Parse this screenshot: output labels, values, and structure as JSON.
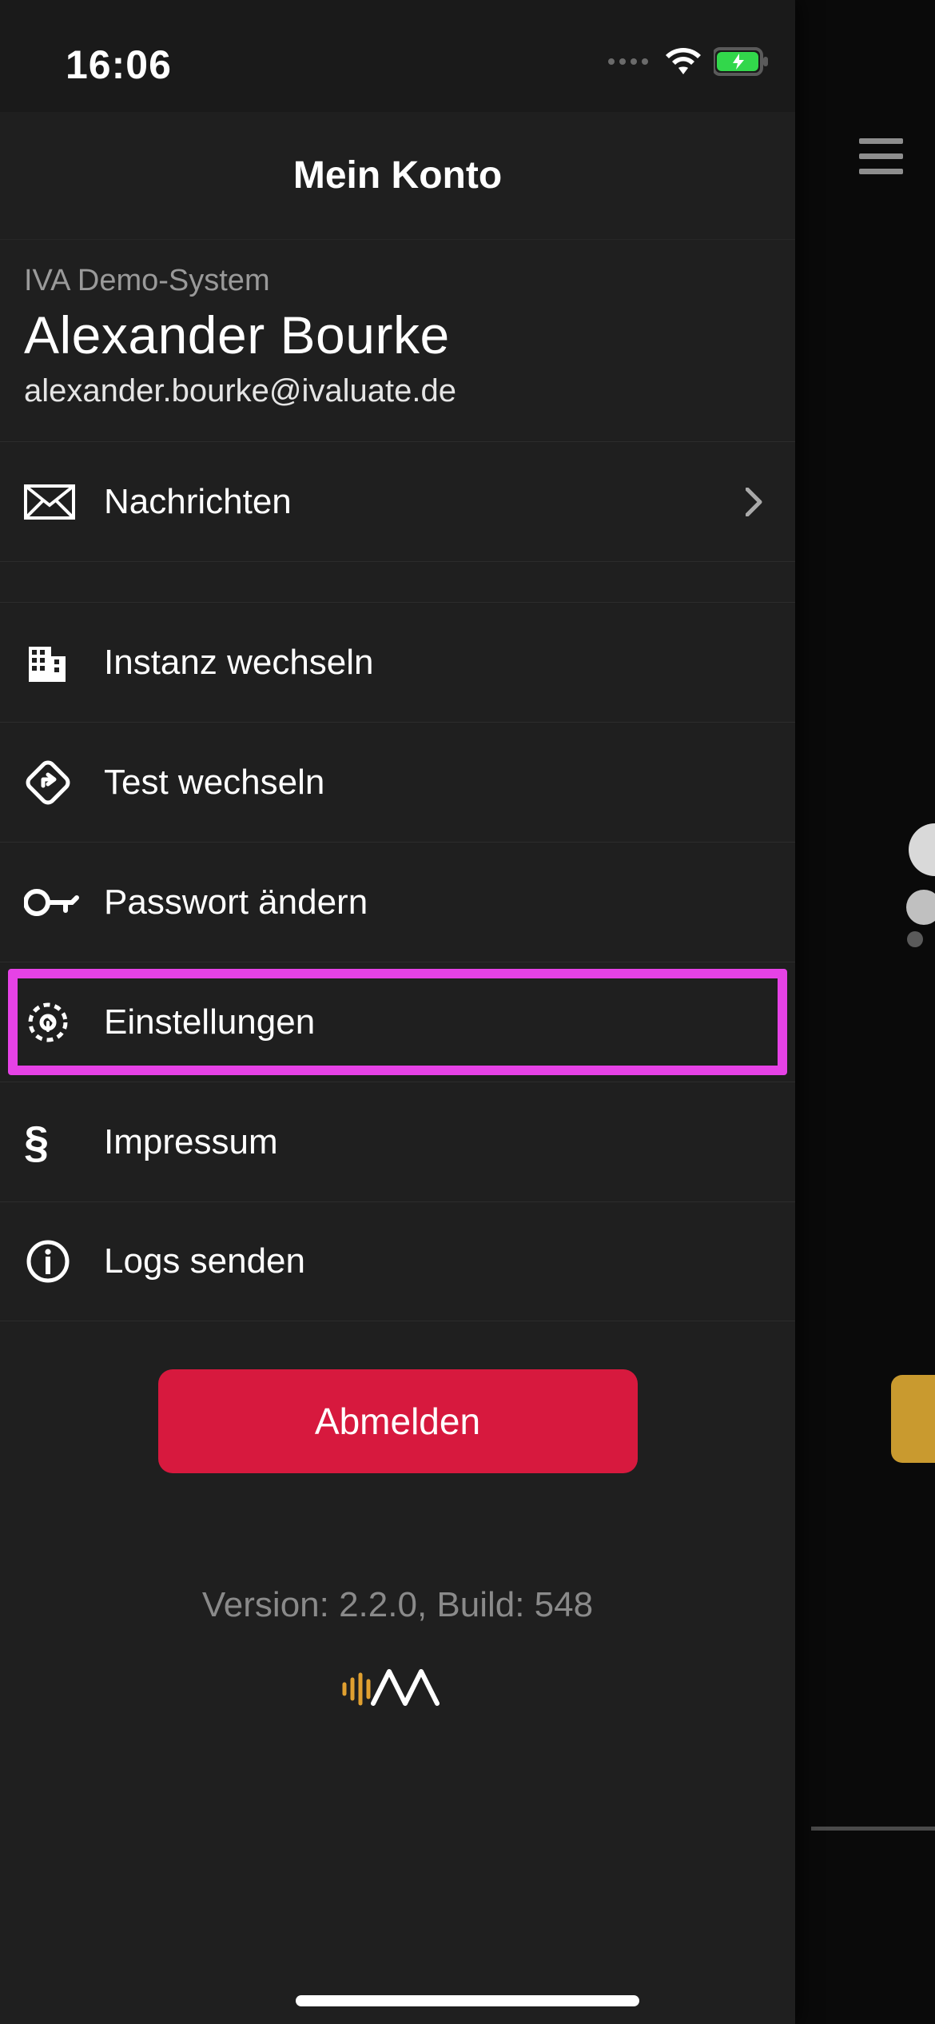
{
  "status": {
    "time": "16:06"
  },
  "header": {
    "title": "Mein Konto"
  },
  "account": {
    "system": "IVA Demo-System",
    "name": "Alexander Bourke",
    "email": "alexander.bourke@ivaluate.de"
  },
  "messages": {
    "label": "Nachrichten"
  },
  "menu": {
    "switch_instance": "Instanz wechseln",
    "switch_test": "Test wechseln",
    "change_password": "Passwort ändern",
    "settings": "Einstellungen",
    "imprint": "Impressum",
    "send_logs": "Logs senden"
  },
  "logout": {
    "label": "Abmelden"
  },
  "footer": {
    "version": "Version: 2.2.0, Build: 548"
  },
  "colors": {
    "highlight": "#e642e6",
    "danger": "#d7193e"
  }
}
